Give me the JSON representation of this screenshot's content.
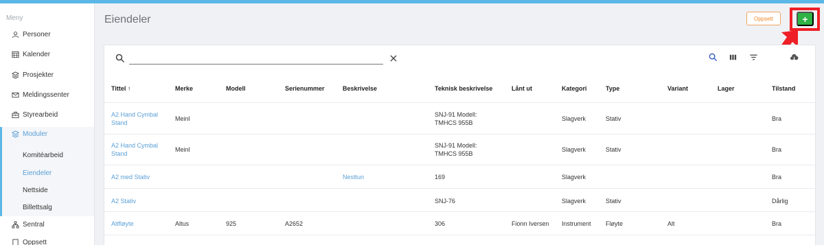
{
  "sidebar": {
    "menu_title": "Meny",
    "items": [
      {
        "label": "Personer"
      },
      {
        "label": "Kalender"
      },
      {
        "label": "Prosjekter"
      },
      {
        "label": "Meldingssenter"
      },
      {
        "label": "Styrearbeid"
      },
      {
        "label": "Moduler"
      },
      {
        "label": "Sentral"
      },
      {
        "label": "Oppsett"
      }
    ],
    "subitems": [
      {
        "label": "Komitéarbeid"
      },
      {
        "label": "Eiendeler"
      },
      {
        "label": "Nettside"
      },
      {
        "label": "Billettsalg"
      }
    ]
  },
  "header": {
    "title": "Eiendeler",
    "oppsett_label": "Oppsett",
    "add_label": "+"
  },
  "search": {
    "placeholder": "",
    "value": ""
  },
  "table": {
    "columns": [
      "Tittel",
      "Merke",
      "Modell",
      "Serienummer",
      "Beskrivelse",
      "Teknisk beskrivelse",
      "Lånt ut",
      "Kategori",
      "Type",
      "Variant",
      "Lager",
      "Tilstand"
    ],
    "sort_indicator": "↑",
    "rows": [
      {
        "tittel": [
          "A2 Hand Cymbal",
          "Stand"
        ],
        "merke": "Meinl",
        "modell": "",
        "serienummer": "",
        "beskrivelse": "",
        "teknisk": [
          "SNJ-91 Modell:",
          "TMHCS 955B"
        ],
        "lant_ut": "",
        "kategori": "Slagverk",
        "type": "Stativ",
        "variant": "",
        "lager": "",
        "tilstand": "Bra"
      },
      {
        "tittel": [
          "A2 Hand Cymbal",
          "Stand"
        ],
        "merke": "Meinl",
        "modell": "",
        "serienummer": "",
        "beskrivelse": "",
        "teknisk": [
          "SNJ-91 Modell:",
          "TMHCS 955B"
        ],
        "lant_ut": "",
        "kategori": "Slagverk",
        "type": "Stativ",
        "variant": "",
        "lager": "",
        "tilstand": "Bra"
      },
      {
        "tittel": [
          "A2 med Stativ"
        ],
        "merke": "",
        "modell": "",
        "serienummer": "",
        "beskrivelse": "Nesttun",
        "teknisk": [
          "169"
        ],
        "lant_ut": "",
        "kategori": "Slagverk",
        "type": "",
        "variant": "",
        "lager": "",
        "tilstand": "Bra"
      },
      {
        "tittel": [
          "A2 Stativ"
        ],
        "merke": "",
        "modell": "",
        "serienummer": "",
        "beskrivelse": "",
        "teknisk": [
          "SNJ-76"
        ],
        "lant_ut": "",
        "kategori": "Slagverk",
        "type": "Stativ",
        "variant": "",
        "lager": "",
        "tilstand": "Dårlig"
      },
      {
        "tittel": [
          "Altfløyte"
        ],
        "merke": "Altus",
        "modell": "925",
        "serienummer": "A2652",
        "beskrivelse": "",
        "teknisk": [
          "306"
        ],
        "lant_ut": "Fionn Iversen",
        "kategori": "Instrument",
        "type": "Fløyte",
        "variant": "Alt",
        "lager": "",
        "tilstand": "Bra"
      }
    ]
  },
  "icons": {
    "search": "search-icon",
    "clear": "close-icon",
    "table_search": "search-icon",
    "columns": "columns-icon",
    "filter": "filter-icon",
    "download": "cloud-download-icon"
  },
  "colors": {
    "accent": "#5bb7e6",
    "link": "#5a9fd6",
    "add_button": "#2fb344",
    "oppsett_button": "#f08a2b",
    "highlight": "#ee1f26"
  }
}
